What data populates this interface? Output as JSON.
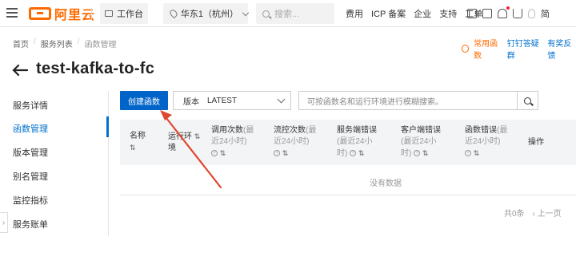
{
  "topbar": {
    "logo_text": "阿里云",
    "workbench_label": "工作台",
    "region_label": "华东1（杭州）",
    "search_placeholder": "搜索...",
    "nav": [
      "费用",
      "ICP 备案",
      "企业",
      "支持",
      "工单"
    ],
    "icons": [
      "code-icon",
      "terminal-icon",
      "bell-icon",
      "cart-icon",
      "bulb-icon"
    ],
    "avatar_text": "简"
  },
  "breadcrumb": [
    "首页",
    "服务列表",
    "函数管理"
  ],
  "header_links": {
    "common": "常用函数",
    "dingtalk": "钉钉答疑群",
    "feedback": "有奖反馈"
  },
  "page_title": "test-kafka-to-fc",
  "sidebar": {
    "items": [
      {
        "label": "服务详情",
        "active": false
      },
      {
        "label": "函数管理",
        "active": true
      },
      {
        "label": "版本管理",
        "active": false
      },
      {
        "label": "别名管理",
        "active": false
      },
      {
        "label": "监控指标",
        "active": false
      },
      {
        "label": "服务账单",
        "active": false
      }
    ]
  },
  "toolbar": {
    "create_label": "创建函数",
    "version_label": "版本",
    "version_value": "LATEST",
    "search_placeholder": "可按函数名和运行环境进行模糊搜索。"
  },
  "table": {
    "columns": [
      {
        "line1": "名称",
        "line2": ""
      },
      {
        "line1": "运行环",
        "line2": "境"
      },
      {
        "line1": "调用次数",
        "sub1": "(最",
        "line2": "近24小时)"
      },
      {
        "line1": "流控次数",
        "sub1": "(最",
        "line2": "近24小时)"
      },
      {
        "line1": "服务端错误",
        "line2": "(最近24小",
        "line3": "时)"
      },
      {
        "line1": "客户端错误",
        "line2": "(最近24小",
        "line3": "时)"
      },
      {
        "line1": "函数错误",
        "sub1": "(最",
        "line2": "近24小时)"
      },
      {
        "line1": "操作"
      }
    ],
    "empty_text": "没有数据"
  },
  "pager": {
    "total": "共0条",
    "prev": "上一页"
  },
  "colors": {
    "accent": "#0064c8",
    "brand": "#ff6a00",
    "annotation": "#e0472f"
  }
}
